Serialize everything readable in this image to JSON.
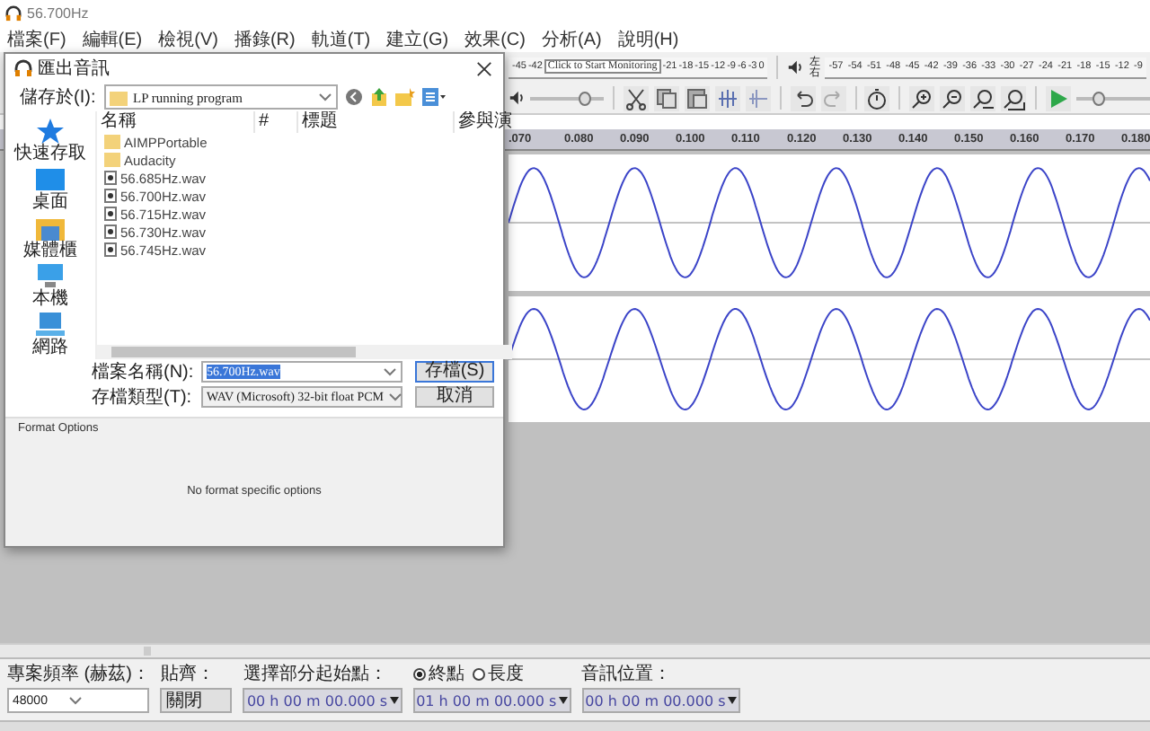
{
  "window": {
    "title": "56.700Hz"
  },
  "menu": [
    "檔案(F)",
    "編輯(E)",
    "檢視(V)",
    "播錄(R)",
    "軌道(T)",
    "建立(G)",
    "效果(C)",
    "分析(A)",
    "說明(H)"
  ],
  "recording_meter": {
    "ticks_before": [
      "-45",
      "-42"
    ],
    "button": "Click to Start Monitoring",
    "ticks_after": [
      "-21",
      "-18",
      "-15",
      "-12",
      "-9",
      "-6",
      "-3",
      "0"
    ]
  },
  "playback_meter": {
    "channels": [
      "左",
      "右"
    ],
    "ticks": [
      "-57",
      "-54",
      "-51",
      "-48",
      "-45",
      "-42",
      "-39",
      "-36",
      "-33",
      "-30",
      "-27",
      "-24",
      "-21",
      "-18",
      "-15",
      "-12",
      "-9"
    ]
  },
  "volume_slider": {
    "level": 0.72
  },
  "play_speed_slider": {
    "level": 0.3
  },
  "timeline": {
    "ticks": [
      ".070",
      "0.080",
      "0.090",
      "0.100",
      "0.110",
      "0.120",
      "0.130",
      "0.140",
      "0.150",
      "0.160",
      "0.170",
      "0.180"
    ]
  },
  "dialog": {
    "title": "匯出音訊",
    "look_in_label": "儲存於(I):",
    "look_in": "LP running program",
    "places": [
      "快速存取",
      "桌面",
      "媒體櫃",
      "本機",
      "網路"
    ],
    "columns": [
      "名稱",
      "#",
      "標題",
      "參與演"
    ],
    "files": [
      {
        "kind": "folder",
        "name": "AIMPPortable"
      },
      {
        "kind": "folder",
        "name": "Audacity"
      },
      {
        "kind": "file",
        "name": "56.685Hz.wav"
      },
      {
        "kind": "file",
        "name": "56.700Hz.wav"
      },
      {
        "kind": "file",
        "name": "56.715Hz.wav"
      },
      {
        "kind": "file",
        "name": "56.730Hz.wav"
      },
      {
        "kind": "file",
        "name": "56.745Hz.wav"
      }
    ],
    "file_name_label": "檔案名稱(N):",
    "file_name": "56.700Hz.wav",
    "file_name_selected": true,
    "file_type_label": "存檔類型(T):",
    "file_type": "WAV (Microsoft) 32-bit float PCM",
    "save_button": "存檔(S)",
    "cancel_button": "取消",
    "format_options_title": "Format Options",
    "format_options_message": "No format specific options"
  },
  "selection_bar": {
    "rate_label": "專案頻率 (赫茲)：",
    "rate": "48000",
    "snap_label": "貼齊：",
    "snap": "關閉",
    "start_label": "選擇部分起始點：",
    "start": "00 h 00 m 00.000 s",
    "end_options": [
      {
        "label": "終點",
        "selected": true
      },
      {
        "label": "長度",
        "selected": false
      }
    ],
    "end": "01 h 00 m 00.000 s",
    "position_label": "音訊位置：",
    "position": "00 h 00 m 00.000 s"
  }
}
